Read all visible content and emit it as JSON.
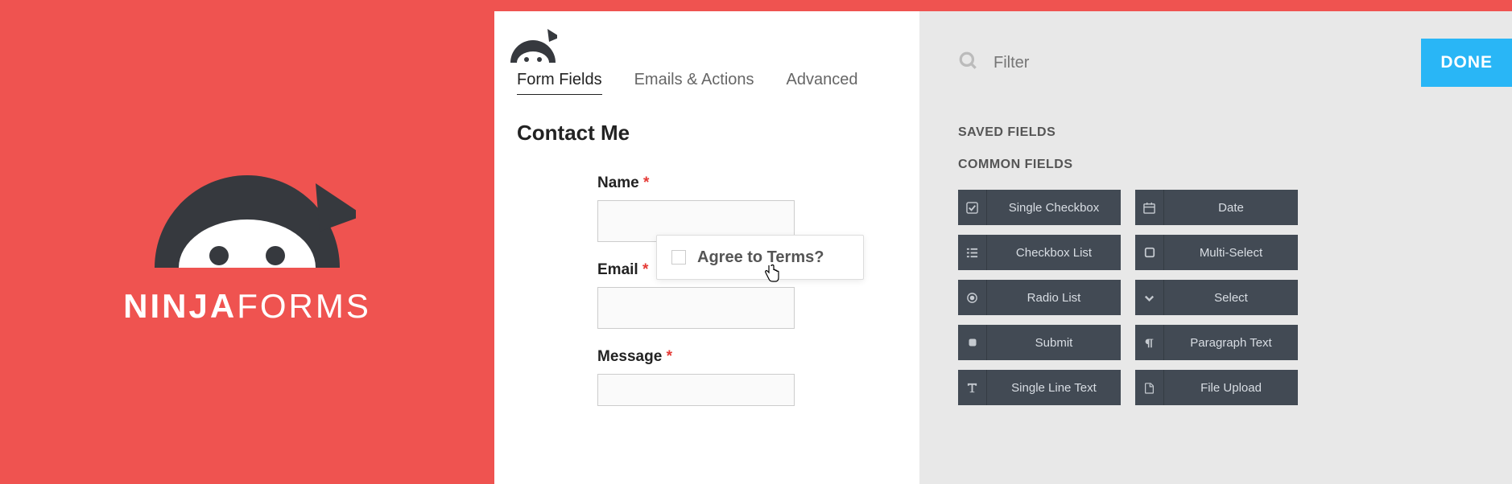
{
  "brand": {
    "name_bold": "NINJA",
    "name_light": "FORMS"
  },
  "tabs": [
    {
      "label": "Form Fields",
      "active": true
    },
    {
      "label": "Emails & Actions",
      "active": false
    },
    {
      "label": "Advanced",
      "active": false
    }
  ],
  "form": {
    "title": "Contact Me",
    "fields": [
      {
        "label": "Name",
        "required": true
      },
      {
        "label": "Email",
        "required": true
      },
      {
        "label": "Message",
        "required": true
      }
    ]
  },
  "drag_field": {
    "label": "Agree to Terms?"
  },
  "sidebar": {
    "filter_placeholder": "Filter",
    "done_label": "DONE",
    "sections": {
      "saved": "SAVED FIELDS",
      "common": "COMMON FIELDS"
    },
    "common_fields": [
      {
        "icon": "check-square",
        "label": "Single Checkbox"
      },
      {
        "icon": "calendar",
        "label": "Date"
      },
      {
        "icon": "list",
        "label": "Checkbox List"
      },
      {
        "icon": "square",
        "label": "Multi-Select"
      },
      {
        "icon": "radio",
        "label": "Radio List"
      },
      {
        "icon": "chevron-down",
        "label": "Select"
      },
      {
        "icon": "square-solid",
        "label": "Submit"
      },
      {
        "icon": "paragraph",
        "label": "Paragraph Text"
      },
      {
        "icon": "text",
        "label": "Single Line Text"
      },
      {
        "icon": "file",
        "label": "File Upload"
      }
    ]
  }
}
